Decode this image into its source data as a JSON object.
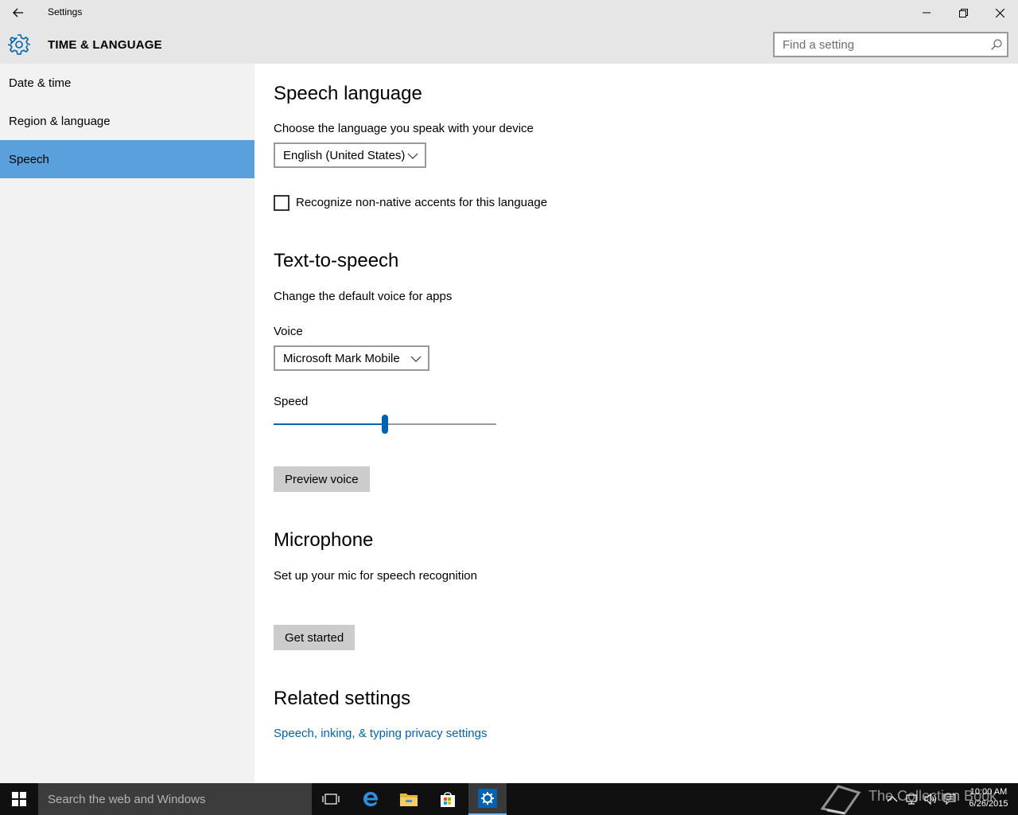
{
  "window": {
    "title": "Settings"
  },
  "header": {
    "section_title": "TIME & LANGUAGE",
    "search_placeholder": "Find a setting"
  },
  "sidebar": {
    "items": [
      {
        "label": "Date & time",
        "selected": false
      },
      {
        "label": "Region & language",
        "selected": false
      },
      {
        "label": "Speech",
        "selected": true
      }
    ]
  },
  "speech_language": {
    "heading": "Speech language",
    "description": "Choose the language you speak with your device",
    "language_value": "English (United States)",
    "accents_checkbox_label": "Recognize non-native accents for this language",
    "accents_checked": false
  },
  "tts": {
    "heading": "Text-to-speech",
    "description": "Change the default voice for apps",
    "voice_label": "Voice",
    "voice_value": "Microsoft Mark Mobile",
    "speed_label": "Speed",
    "speed_fraction": 0.5,
    "preview_button": "Preview voice"
  },
  "microphone": {
    "heading": "Microphone",
    "description": "Set up your mic for speech recognition",
    "get_started_button": "Get started"
  },
  "related": {
    "heading": "Related settings",
    "privacy_link": "Speech, inking, & typing privacy settings"
  },
  "taskbar": {
    "search_text": "Search the web and Windows",
    "time": "10:00 AM",
    "date": "6/26/2015",
    "watermark": "The Collection Book"
  },
  "colors": {
    "accent": "#0063b1",
    "selected_nav": "#5aa0dc",
    "chrome": "#e6e6e6",
    "sidebar": "#f2f2f2",
    "taskbar": "#101010"
  }
}
